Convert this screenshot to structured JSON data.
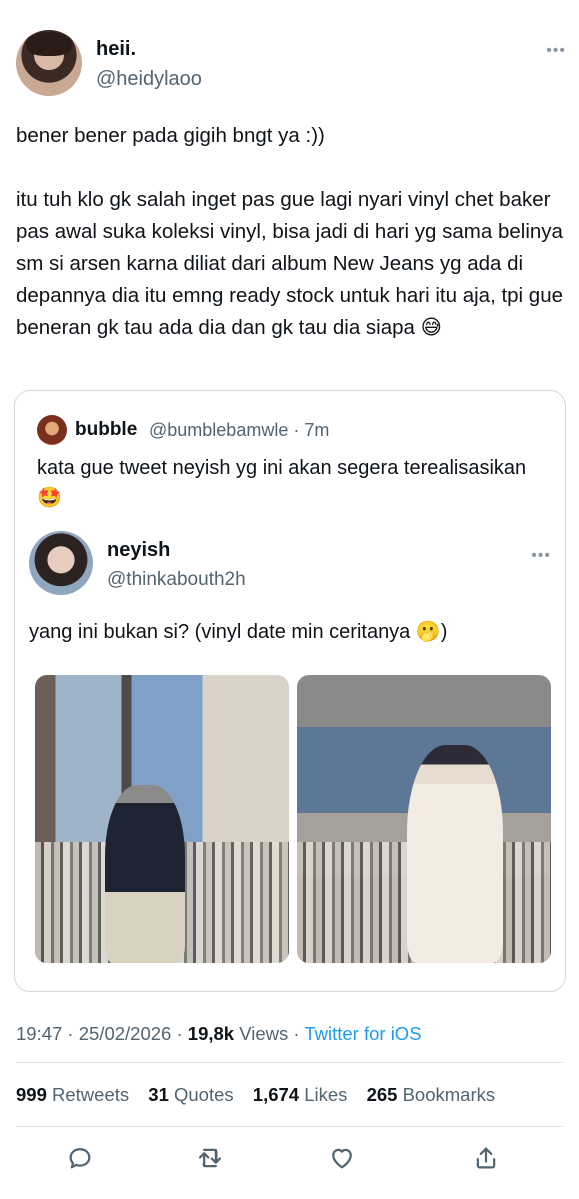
{
  "tweet": {
    "author_name": "heii.",
    "author_handle": "@heidylaoo",
    "text": "bener bener pada gigih bngt ya :))\n\nitu tuh klo gk salah inget pas gue lagi nyari vinyl chet baker pas awal suka koleksi vinyl, bisa jadi di hari yg sama belinya sm si arsen karna diliat dari album New Jeans yg ada di depannya dia itu emng ready stock untuk hari itu aja, tpi gue beneran gk tau ada dia dan gk tau dia siapa 😅",
    "more_icon": "more-horizontal-icon"
  },
  "quote": {
    "author_name": "bubble",
    "author_handle": "@bumblebamwle",
    "time": "· 7m",
    "text": "kata gue tweet neyish yg ini akan segera terealisasikan 🤩",
    "nested": {
      "author_name": "neyish",
      "author_handle": "@thinkabouth2h",
      "text": "yang ini bukan si? (vinyl date min ceritanya 🫢)",
      "more_icon": "more-horizontal-icon"
    }
  },
  "meta": {
    "time": "19:47 · 25/02/2026 · ",
    "views_count": "19,8k",
    "views_label": " Views · ",
    "source": "Twitter for iOS"
  },
  "stats": {
    "retweets_count": "999",
    "retweets_label": "Retweets",
    "quotes_count": "31",
    "quotes_label": "Quotes",
    "likes_count": "1,674",
    "likes_label": "Likes",
    "bookmarks_count": "265",
    "bookmarks_label": "Bookmarks"
  },
  "actions": [
    "reply-icon",
    "retweet-icon",
    "like-icon",
    "share-icon"
  ],
  "colors": {
    "text": "#0f1419",
    "secondary": "#536471",
    "link": "#1d9bf0",
    "border": "#cfd9de"
  }
}
